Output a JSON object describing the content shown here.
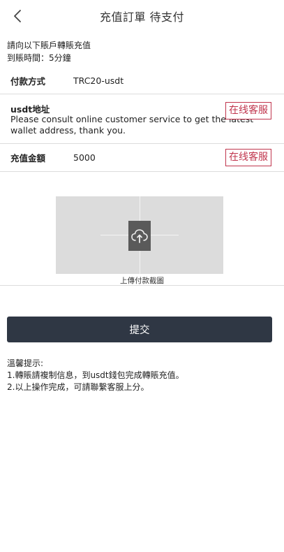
{
  "header": {
    "title": "充值訂單 待支付"
  },
  "intro": {
    "line1": "請向以下賬戶轉賬充值",
    "line2": "到賬時間：5分鐘"
  },
  "payment_method": {
    "label": "付款方式",
    "value": "TRC20-usdt"
  },
  "address": {
    "label": "usdt地址",
    "text": "Please consult online customer service to get the latest wallet address, thank you.",
    "cs_button": "在线客服"
  },
  "amount": {
    "label": "充值金額",
    "value": "5000",
    "cs_button": "在线客服"
  },
  "upload": {
    "label": "上傳付款截圖",
    "icon": "cloud-upload-icon"
  },
  "submit": {
    "label": "提交"
  },
  "tips": {
    "title": "溫馨提示:",
    "line1": "1.轉賬請複制信息，到usdt錢包完成轉賬充值。",
    "line2": "2.以上操作完成，可請聯繫客服上分。"
  },
  "colors": {
    "accent": "#c0354d",
    "button": "#2f3744",
    "divider": "#dcdcdc"
  }
}
